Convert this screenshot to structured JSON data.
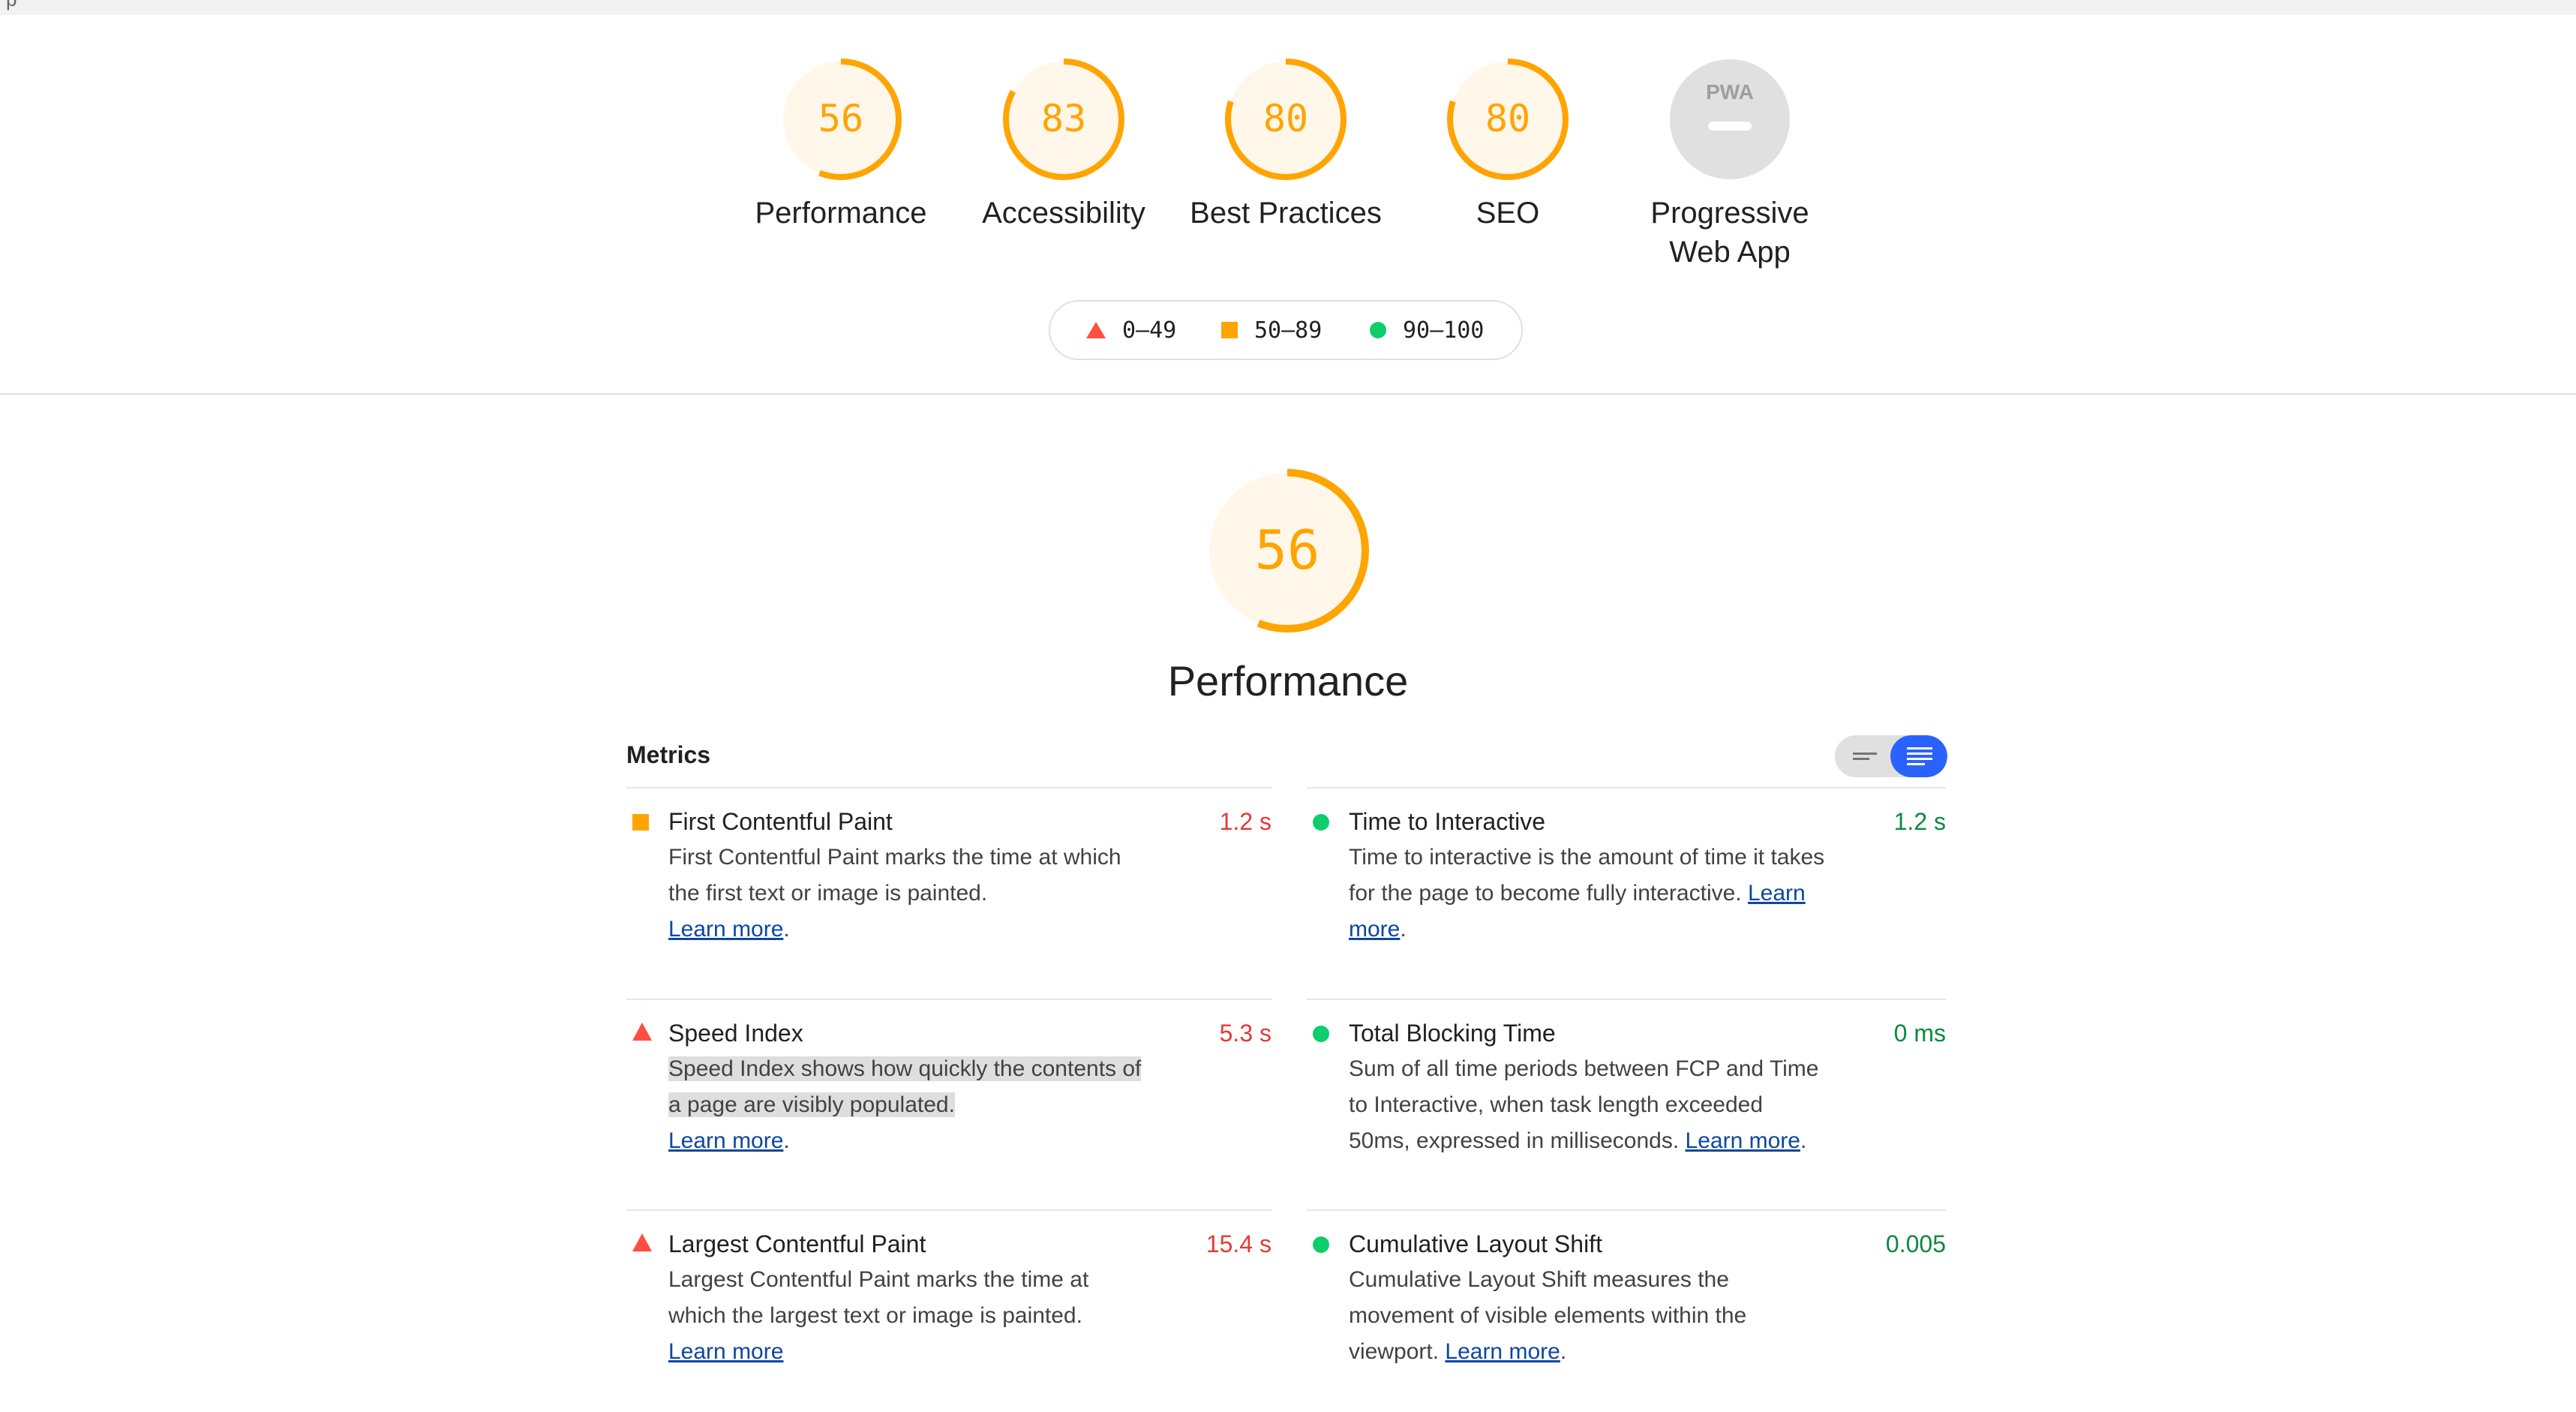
{
  "topbar": {
    "text": "p"
  },
  "summary": {
    "categories": [
      {
        "label": "Performance",
        "score": "56",
        "progress": 0.56
      },
      {
        "label": "Accessibility",
        "score": "83",
        "progress": 0.83
      },
      {
        "label": "Best Practices",
        "score": "80",
        "progress": 0.8
      },
      {
        "label": "SEO",
        "score": "80",
        "progress": 0.8
      },
      {
        "label_line1": "Progressive",
        "label_line2": "Web App",
        "badge": "PWA"
      }
    ]
  },
  "legend": {
    "fail": "0–49",
    "average": "50–89",
    "pass": "90–100"
  },
  "performance": {
    "score": "56",
    "progress": 0.56,
    "title": "Performance"
  },
  "metrics": {
    "heading": "Metrics",
    "learn_more": "Learn more",
    "items": [
      {
        "title": "First Contentful Paint",
        "value": "1.2 s",
        "status": "average",
        "description": "First Contentful Paint marks the time at which the first text or image is painted."
      },
      {
        "title": "Time to Interactive",
        "value": "1.2 s",
        "status": "pass",
        "description": "Time to interactive is the amount of time it takes for the page to become fully interactive."
      },
      {
        "title": "Speed Index",
        "value": "5.3 s",
        "status": "fail",
        "description": "Speed Index shows how quickly the contents of a page are visibly populated."
      },
      {
        "title": "Total Blocking Time",
        "value": "0 ms",
        "status": "pass",
        "description": "Sum of all time periods between FCP and Time to Interactive, when task length exceeded 50ms, expressed in milliseconds."
      },
      {
        "title": "Largest Contentful Paint",
        "value": "15.4 s",
        "status": "fail",
        "description": "Largest Contentful Paint marks the time at which the largest text or image is painted."
      },
      {
        "title": "Cumulative Layout Shift",
        "value": "0.005",
        "status": "pass",
        "description": "Cumulative Layout Shift measures the movement of visible elements within the viewport."
      }
    ]
  },
  "colors": {
    "fail": "#ff4e42",
    "average": "#ffa400",
    "pass": "#0cce6b",
    "accent": "#2962ff"
  }
}
